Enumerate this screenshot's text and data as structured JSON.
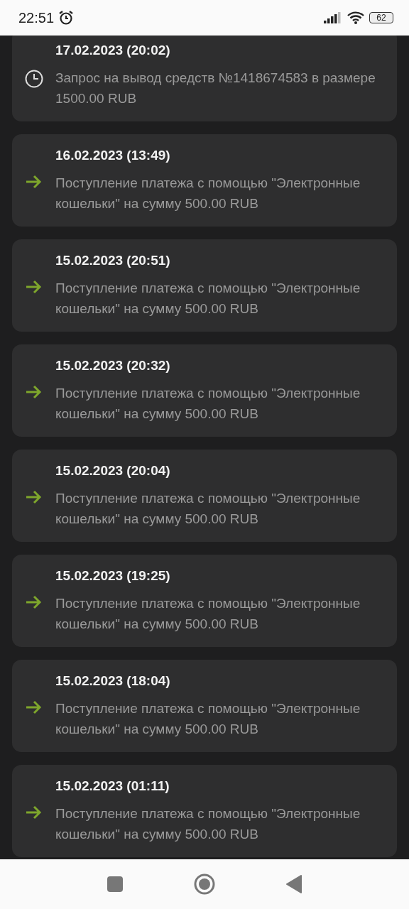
{
  "status_bar": {
    "time": "22:51",
    "battery": "62"
  },
  "transactions": [
    {
      "kind": "withdrawal",
      "date": "17.02.2023 (20:02)",
      "description": "Запрос на вывод средств №1418674583 в размере 1500.00 RUB"
    },
    {
      "kind": "deposit",
      "date": "16.02.2023 (13:49)",
      "description": "Поступление платежа с помощью \"Электронные кошельки\" на сумму 500.00 RUB"
    },
    {
      "kind": "deposit",
      "date": "15.02.2023 (20:51)",
      "description": "Поступление платежа с помощью \"Электронные кошельки\" на сумму 500.00 RUB"
    },
    {
      "kind": "deposit",
      "date": "15.02.2023 (20:32)",
      "description": "Поступление платежа с помощью \"Электронные кошельки\" на сумму 500.00 RUB"
    },
    {
      "kind": "deposit",
      "date": "15.02.2023 (20:04)",
      "description": "Поступление платежа с помощью \"Электронные кошельки\" на сумму 500.00 RUB"
    },
    {
      "kind": "deposit",
      "date": "15.02.2023 (19:25)",
      "description": "Поступление платежа с помощью \"Электронные кошельки\" на сумму 500.00 RUB"
    },
    {
      "kind": "deposit",
      "date": "15.02.2023 (18:04)",
      "description": "Поступление платежа с помощью \"Электронные кошельки\" на сумму 500.00 RUB"
    },
    {
      "kind": "deposit",
      "date": "15.02.2023 (01:11)",
      "description": "Поступление платежа с помощью \"Электронные кошельки\" на сумму 500.00 RUB"
    }
  ]
}
